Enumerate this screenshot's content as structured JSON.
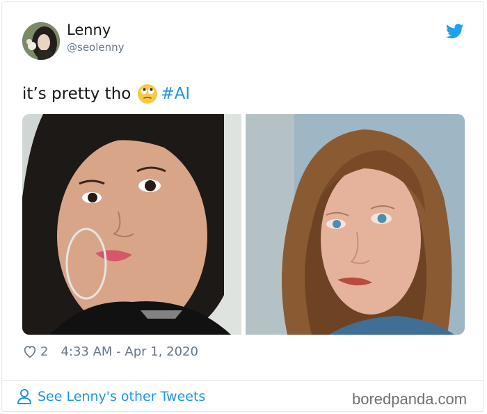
{
  "tweet": {
    "author_name": "Lenny",
    "author_handle": "@seolenny",
    "text": "it’s pretty tho",
    "emoji": "face-with-rolling-eyes",
    "hashtag": "#AI",
    "likes": "2",
    "timestamp": "4:33 AM - Apr 1, 2020"
  },
  "footer": {
    "other_tweets_label": "See Lenny's other Tweets",
    "watermark": "boredpanda.com"
  },
  "icons": {
    "brand": "twitter-bird-icon",
    "like": "heart-icon",
    "profile": "person-icon"
  },
  "colors": {
    "link": "#1b95e0",
    "secondary_text": "#657786",
    "border": "#e1e8ed"
  }
}
